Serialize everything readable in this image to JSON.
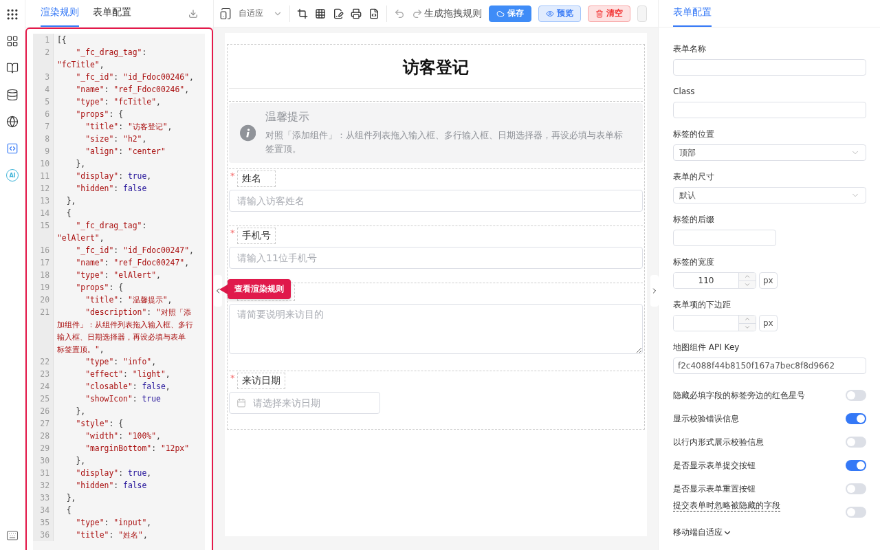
{
  "rail": {
    "items": [
      {
        "kind": "grid",
        "selected": false
      },
      {
        "kind": "book",
        "selected": false
      },
      {
        "kind": "database",
        "selected": false
      },
      {
        "kind": "globe",
        "selected": false
      },
      {
        "kind": "code",
        "selected": true
      },
      {
        "kind": "ai",
        "label": "AI",
        "selected": false
      }
    ]
  },
  "left_panel": {
    "tabs": [
      {
        "label": "渲染规则",
        "selected": true
      },
      {
        "label": "表单配置",
        "selected": false
      }
    ],
    "code_lines": [
      {
        "n": "1",
        "rows": [
          [
            {
              "kind": "punct",
              "text": "[{"
            }
          ]
        ]
      },
      {
        "n": "2",
        "rows": [
          [
            {
              "kind": "punct",
              "text": "    "
            },
            {
              "kind": "string",
              "text": "\"_fc_drag_tag\""
            },
            {
              "kind": "punct",
              "text": ":"
            }
          ],
          [
            {
              "kind": "string",
              "text": "\"fcTitle\""
            },
            {
              "kind": "punct",
              "text": ","
            }
          ]
        ]
      },
      {
        "n": "3",
        "rows": [
          [
            {
              "kind": "punct",
              "text": "    "
            },
            {
              "kind": "string",
              "text": "\"_fc_id\""
            },
            {
              "kind": "punct",
              "text": ": "
            },
            {
              "kind": "string",
              "text": "\"id_Fdoc00246\""
            },
            {
              "kind": "punct",
              "text": ","
            }
          ]
        ]
      },
      {
        "n": "4",
        "rows": [
          [
            {
              "kind": "punct",
              "text": "    "
            },
            {
              "kind": "string",
              "text": "\"name\""
            },
            {
              "kind": "punct",
              "text": ": "
            },
            {
              "kind": "string",
              "text": "\"ref_Fdoc00246\""
            },
            {
              "kind": "punct",
              "text": ","
            }
          ]
        ]
      },
      {
        "n": "5",
        "rows": [
          [
            {
              "kind": "punct",
              "text": "    "
            },
            {
              "kind": "string",
              "text": "\"type\""
            },
            {
              "kind": "punct",
              "text": ": "
            },
            {
              "kind": "string",
              "text": "\"fcTitle\""
            },
            {
              "kind": "punct",
              "text": ","
            }
          ]
        ]
      },
      {
        "n": "6",
        "rows": [
          [
            {
              "kind": "punct",
              "text": "    "
            },
            {
              "kind": "string",
              "text": "\"props\""
            },
            {
              "kind": "punct",
              "text": ": {"
            }
          ]
        ]
      },
      {
        "n": "7",
        "rows": [
          [
            {
              "kind": "punct",
              "text": "      "
            },
            {
              "kind": "string",
              "text": "\"title\""
            },
            {
              "kind": "punct",
              "text": ": "
            },
            {
              "kind": "string",
              "text": "\"访客登记\""
            },
            {
              "kind": "punct",
              "text": ","
            }
          ]
        ]
      },
      {
        "n": "8",
        "rows": [
          [
            {
              "kind": "punct",
              "text": "      "
            },
            {
              "kind": "string",
              "text": "\"size\""
            },
            {
              "kind": "punct",
              "text": ": "
            },
            {
              "kind": "string",
              "text": "\"h2\""
            },
            {
              "kind": "punct",
              "text": ","
            }
          ]
        ]
      },
      {
        "n": "9",
        "rows": [
          [
            {
              "kind": "punct",
              "text": "      "
            },
            {
              "kind": "string",
              "text": "\"align\""
            },
            {
              "kind": "punct",
              "text": ": "
            },
            {
              "kind": "string",
              "text": "\"center\""
            }
          ]
        ]
      },
      {
        "n": "10",
        "rows": [
          [
            {
              "kind": "punct",
              "text": "    },"
            }
          ]
        ]
      },
      {
        "n": "11",
        "rows": [
          [
            {
              "kind": "punct",
              "text": "    "
            },
            {
              "kind": "string",
              "text": "\"display\""
            },
            {
              "kind": "punct",
              "text": ": "
            },
            {
              "kind": "keyword",
              "text": "true"
            },
            {
              "kind": "punct",
              "text": ","
            }
          ]
        ]
      },
      {
        "n": "12",
        "rows": [
          [
            {
              "kind": "punct",
              "text": "    "
            },
            {
              "kind": "string",
              "text": "\"hidden\""
            },
            {
              "kind": "punct",
              "text": ": "
            },
            {
              "kind": "keyword",
              "text": "false"
            }
          ]
        ]
      },
      {
        "n": "13",
        "rows": [
          [
            {
              "kind": "punct",
              "text": "  },"
            }
          ]
        ]
      },
      {
        "n": "14",
        "rows": [
          [
            {
              "kind": "punct",
              "text": "  {"
            }
          ]
        ]
      },
      {
        "n": "15",
        "rows": [
          [
            {
              "kind": "punct",
              "text": "    "
            },
            {
              "kind": "string",
              "text": "\"_fc_drag_tag\""
            },
            {
              "kind": "punct",
              "text": ":"
            }
          ],
          [
            {
              "kind": "string",
              "text": "\"elAlert\""
            },
            {
              "kind": "punct",
              "text": ","
            }
          ]
        ]
      },
      {
        "n": "16",
        "rows": [
          [
            {
              "kind": "punct",
              "text": "    "
            },
            {
              "kind": "string",
              "text": "\"_fc_id\""
            },
            {
              "kind": "punct",
              "text": ": "
            },
            {
              "kind": "string",
              "text": "\"id_Fdoc00247\""
            },
            {
              "kind": "punct",
              "text": ","
            }
          ]
        ]
      },
      {
        "n": "17",
        "rows": [
          [
            {
              "kind": "punct",
              "text": "    "
            },
            {
              "kind": "string",
              "text": "\"name\""
            },
            {
              "kind": "punct",
              "text": ": "
            },
            {
              "kind": "string",
              "text": "\"ref_Fdoc00247\""
            },
            {
              "kind": "punct",
              "text": ","
            }
          ]
        ]
      },
      {
        "n": "18",
        "rows": [
          [
            {
              "kind": "punct",
              "text": "    "
            },
            {
              "kind": "string",
              "text": "\"type\""
            },
            {
              "kind": "punct",
              "text": ": "
            },
            {
              "kind": "string",
              "text": "\"elAlert\""
            },
            {
              "kind": "punct",
              "text": ","
            }
          ]
        ]
      },
      {
        "n": "19",
        "rows": [
          [
            {
              "kind": "punct",
              "text": "    "
            },
            {
              "kind": "string",
              "text": "\"props\""
            },
            {
              "kind": "punct",
              "text": ": {"
            }
          ]
        ]
      },
      {
        "n": "20",
        "rows": [
          [
            {
              "kind": "punct",
              "text": "      "
            },
            {
              "kind": "string",
              "text": "\"title\""
            },
            {
              "kind": "punct",
              "text": ": "
            },
            {
              "kind": "string",
              "text": "\"温馨提示\""
            },
            {
              "kind": "punct",
              "text": ","
            }
          ]
        ]
      },
      {
        "n": "21",
        "rows": [
          [
            {
              "kind": "punct",
              "text": "      "
            },
            {
              "kind": "string",
              "text": "\"description\""
            },
            {
              "kind": "punct",
              "text": ": "
            },
            {
              "kind": "string",
              "text": "\"对照「添"
            }
          ],
          [
            {
              "kind": "string",
              "text": "加组件」：从组件列表拖入输入框、多行"
            }
          ],
          [
            {
              "kind": "string",
              "text": "输入框、日期选择器，再设必填与表单"
            }
          ],
          [
            {
              "kind": "string",
              "text": "标签置顶。\""
            },
            {
              "kind": "punct",
              "text": ","
            }
          ]
        ]
      },
      {
        "n": "22",
        "rows": [
          [
            {
              "kind": "punct",
              "text": "      "
            },
            {
              "kind": "string",
              "text": "\"type\""
            },
            {
              "kind": "punct",
              "text": ": "
            },
            {
              "kind": "string",
              "text": "\"info\""
            },
            {
              "kind": "punct",
              "text": ","
            }
          ]
        ]
      },
      {
        "n": "23",
        "rows": [
          [
            {
              "kind": "punct",
              "text": "      "
            },
            {
              "kind": "string",
              "text": "\"effect\""
            },
            {
              "kind": "punct",
              "text": ": "
            },
            {
              "kind": "string",
              "text": "\"light\""
            },
            {
              "kind": "punct",
              "text": ","
            }
          ]
        ]
      },
      {
        "n": "24",
        "rows": [
          [
            {
              "kind": "punct",
              "text": "      "
            },
            {
              "kind": "string",
              "text": "\"closable\""
            },
            {
              "kind": "punct",
              "text": ": "
            },
            {
              "kind": "keyword",
              "text": "false"
            },
            {
              "kind": "punct",
              "text": ","
            }
          ]
        ]
      },
      {
        "n": "25",
        "rows": [
          [
            {
              "kind": "punct",
              "text": "      "
            },
            {
              "kind": "string",
              "text": "\"showIcon\""
            },
            {
              "kind": "punct",
              "text": ": "
            },
            {
              "kind": "keyword",
              "text": "true"
            }
          ]
        ]
      },
      {
        "n": "26",
        "rows": [
          [
            {
              "kind": "punct",
              "text": "    },"
            }
          ]
        ]
      },
      {
        "n": "27",
        "rows": [
          [
            {
              "kind": "punct",
              "text": "    "
            },
            {
              "kind": "string",
              "text": "\"style\""
            },
            {
              "kind": "punct",
              "text": ": {"
            }
          ]
        ]
      },
      {
        "n": "28",
        "rows": [
          [
            {
              "kind": "punct",
              "text": "      "
            },
            {
              "kind": "string",
              "text": "\"width\""
            },
            {
              "kind": "punct",
              "text": ": "
            },
            {
              "kind": "string",
              "text": "\"100%\""
            },
            {
              "kind": "punct",
              "text": ","
            }
          ]
        ]
      },
      {
        "n": "29",
        "rows": [
          [
            {
              "kind": "punct",
              "text": "      "
            },
            {
              "kind": "string",
              "text": "\"marginBottom\""
            },
            {
              "kind": "punct",
              "text": ": "
            },
            {
              "kind": "string",
              "text": "\"12px\""
            }
          ]
        ]
      },
      {
        "n": "30",
        "rows": [
          [
            {
              "kind": "punct",
              "text": "    },"
            }
          ]
        ]
      },
      {
        "n": "31",
        "rows": [
          [
            {
              "kind": "punct",
              "text": "    "
            },
            {
              "kind": "string",
              "text": "\"display\""
            },
            {
              "kind": "punct",
              "text": ": "
            },
            {
              "kind": "keyword",
              "text": "true"
            },
            {
              "kind": "punct",
              "text": ","
            }
          ]
        ]
      },
      {
        "n": "32",
        "rows": [
          [
            {
              "kind": "punct",
              "text": "    "
            },
            {
              "kind": "string",
              "text": "\"hidden\""
            },
            {
              "kind": "punct",
              "text": ": "
            },
            {
              "kind": "keyword",
              "text": "false"
            }
          ]
        ]
      },
      {
        "n": "33",
        "rows": [
          [
            {
              "kind": "punct",
              "text": "  },"
            }
          ]
        ]
      },
      {
        "n": "34",
        "rows": [
          [
            {
              "kind": "punct",
              "text": "  {"
            }
          ]
        ]
      },
      {
        "n": "35",
        "rows": [
          [
            {
              "kind": "punct",
              "text": "    "
            },
            {
              "kind": "string",
              "text": "\"type\""
            },
            {
              "kind": "punct",
              "text": ": "
            },
            {
              "kind": "string",
              "text": "\"input\""
            },
            {
              "kind": "punct",
              "text": ","
            }
          ]
        ]
      },
      {
        "n": "36",
        "rows": [
          [
            {
              "kind": "punct",
              "text": "    "
            },
            {
              "kind": "string",
              "text": "\"title\""
            },
            {
              "kind": "punct",
              "text": ": "
            },
            {
              "kind": "string",
              "text": "\"姓名\""
            },
            {
              "kind": "punct",
              "text": ","
            }
          ]
        ]
      }
    ]
  },
  "callout": "查看渲染规则",
  "toolbar": {
    "device_select": "自适应",
    "action_label": "生成拖拽规则",
    "buttons": [
      {
        "label": "保存",
        "kind": "primary"
      },
      {
        "label": "预览",
        "kind": "info"
      },
      {
        "label": "清空",
        "kind": "danger"
      }
    ]
  },
  "form": {
    "title": "访客登记",
    "alert": {
      "title": "温馨提示",
      "description": "对照「添加组件」：从组件列表拖入输入框、多行输入框、日期选择器，再设必填与表单标签置顶。"
    },
    "fields": [
      {
        "kind": "input",
        "required_mark": "*",
        "label": "姓名",
        "placeholder": "请输入访客姓名"
      },
      {
        "kind": "input",
        "required_mark": "*",
        "label": "手机号",
        "placeholder": "请输入11位手机号"
      },
      {
        "kind": "textarea",
        "placeholder": "请简要说明来访目的"
      },
      {
        "kind": "date",
        "required_mark": "*",
        "label": "来访日期",
        "placeholder": "请选择来访日期"
      }
    ]
  },
  "right_panel": {
    "tabs": [
      {
        "label": "表单配置",
        "selected": true
      }
    ],
    "settings": [
      {
        "kind": "text",
        "label": "表单名称"
      },
      {
        "kind": "text",
        "label": "Class"
      },
      {
        "kind": "select",
        "label": "标签的位置",
        "value": "顶部"
      },
      {
        "kind": "select",
        "label": "表单的尺寸",
        "value": "默认"
      },
      {
        "kind": "short",
        "label": "标签的后缀"
      },
      {
        "kind": "number",
        "label": "标签的宽度",
        "value": "110",
        "unit": "px"
      },
      {
        "kind": "number",
        "label": "表单项的下边距",
        "unit": "px"
      },
      {
        "kind": "text",
        "label": "地图组件 API Key",
        "value": "f2c4088f44b8150f167a7bec8f8d9662"
      },
      {
        "kind": "switch",
        "label": "隐藏必填字段的标签旁边的红色星号",
        "on": false
      },
      {
        "kind": "switch",
        "label": "显示校验错误信息",
        "on": true
      },
      {
        "kind": "switch",
        "label": "以行内形式展示校验信息",
        "on": false
      },
      {
        "kind": "switch",
        "label": "是否显示表单提交按钮",
        "on": true
      },
      {
        "kind": "switch",
        "label": "是否显示表单重置按钮",
        "on": false
      },
      {
        "kind": "switch",
        "label": "提交表单时忽略被隐藏的字段",
        "on": false,
        "tip": true
      },
      {
        "kind": "expand",
        "label": "移动端自适应"
      }
    ]
  }
}
